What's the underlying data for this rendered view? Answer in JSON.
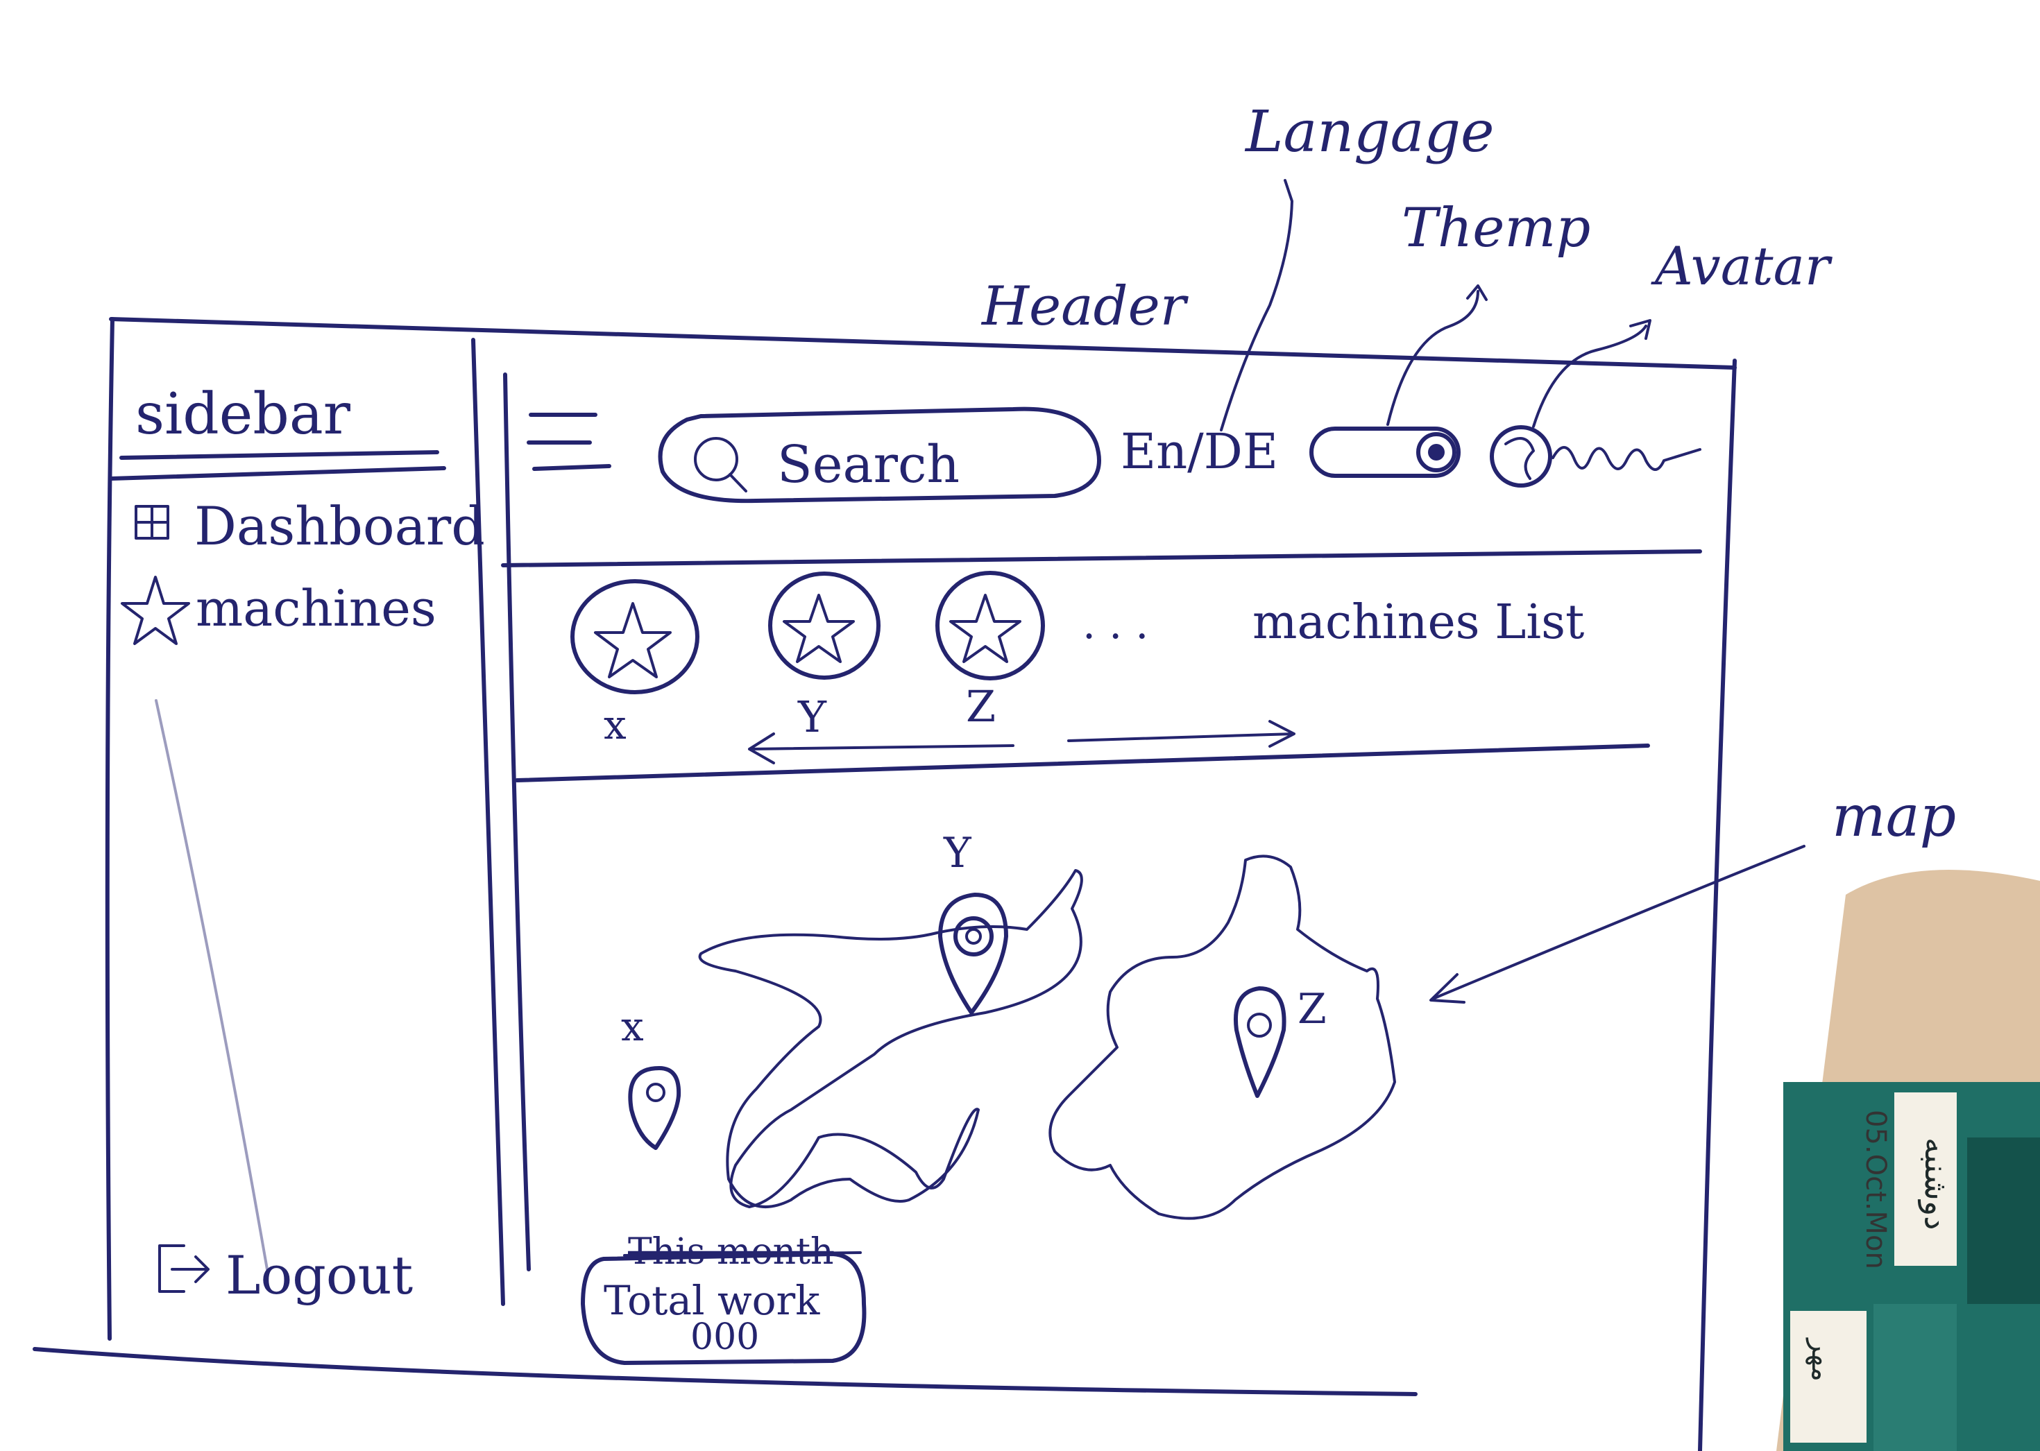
{
  "annotations": {
    "sidebar": "sidebar",
    "header": "Header",
    "language": "Langage",
    "theme": "Themp",
    "avatar": "Avatar",
    "map": "map"
  },
  "sidebar": {
    "items": [
      {
        "label": "Dashboard",
        "icon": "grid-icon"
      },
      {
        "label": "machines",
        "icon": "star-icon"
      }
    ],
    "logout": {
      "label": "Logout",
      "icon": "logout-icon"
    }
  },
  "header": {
    "menu_icon": "hamburger-icon",
    "search": {
      "placeholder": "Search",
      "icon": "search-icon"
    },
    "language": "En/DE",
    "theme_toggle_icon": "theme-toggle-icon",
    "avatar_icon": "avatar-icon"
  },
  "machines_list": {
    "title": "machines List",
    "ellipsis": ". . .",
    "items": [
      {
        "label": "x",
        "icon": "star-icon"
      },
      {
        "label": "Y",
        "icon": "star-icon"
      },
      {
        "label": "Z",
        "icon": "star-icon"
      }
    ]
  },
  "map": {
    "markers": [
      {
        "label": "x"
      },
      {
        "label": "Y"
      },
      {
        "label": "Z"
      }
    ]
  },
  "total_work": {
    "struck_label": "This month",
    "label": "Total work",
    "value": "000"
  },
  "calendar_note": {
    "persian_weekday": "دوشنبه",
    "date": "05.Oct.Mon",
    "persian_month": "مهر"
  },
  "colors": {
    "ink": "#24246e",
    "paper": "#ffffff",
    "calendar_teal": "#1f6f66",
    "calendar_wood": "#c9a37d"
  }
}
